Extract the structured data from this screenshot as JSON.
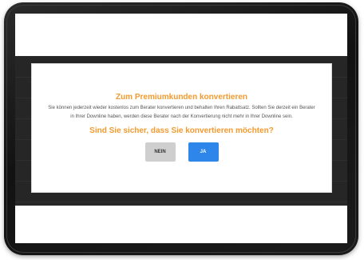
{
  "dialog": {
    "title": "Zum Premiumkunden konvertieren",
    "body": "Sie können jederzeit wieder kostenlos zum Berater konvertieren und behalten Ihren Rabattsatz. Sollten Sie derzeit ein Berater in Ihrer Downline haben, werden diese Berater nach der Konvertierung nicht mehr in Ihrer Downline sein.",
    "question": "Sind Sie sicher, dass Sie konvertieren möchten?",
    "no_label": "NEIN",
    "yes_label": "JA"
  },
  "colors": {
    "accent": "#f39a2e",
    "primary_button": "#2f86ea",
    "secondary_button": "#cfcfcf",
    "overlay": "#262626",
    "device_frame": "#121212"
  }
}
